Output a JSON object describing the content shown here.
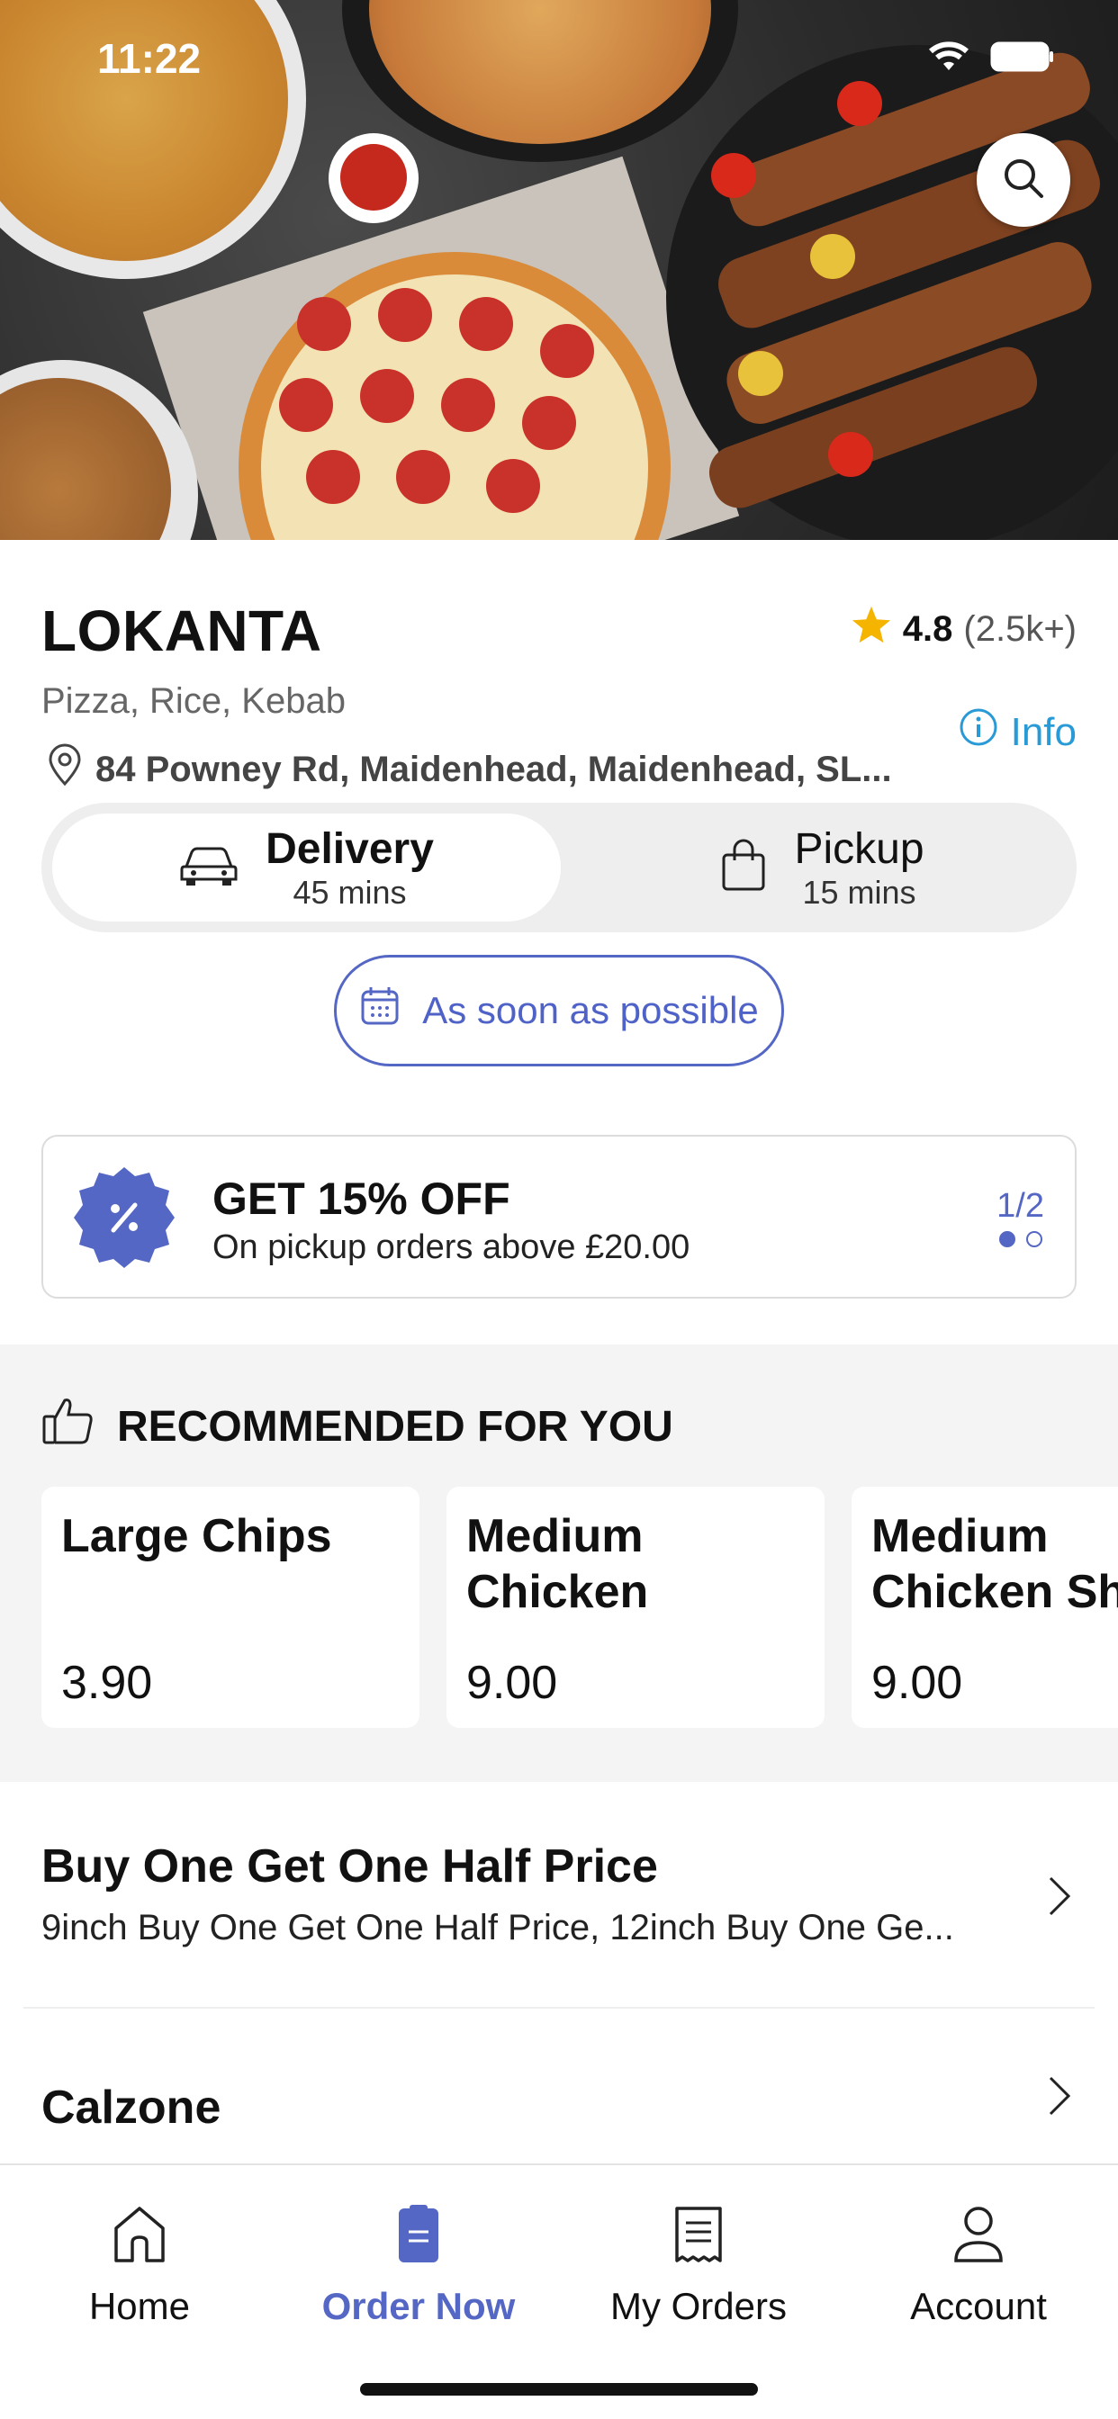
{
  "status": {
    "time": "11:22"
  },
  "restaurant": {
    "name": "LOKANTA",
    "rating": "4.8",
    "rating_count": "(2.5k+)",
    "cuisines": "Pizza, Rice, Kebab",
    "info_label": "Info",
    "address": "84 Powney Rd, Maidenhead, Maidenhead, SL..."
  },
  "order_mode": {
    "delivery": {
      "label": "Delivery",
      "time": "45 mins",
      "selected": true
    },
    "pickup": {
      "label": "Pickup",
      "time": "15 mins",
      "selected": false
    }
  },
  "schedule": {
    "label": "As soon as possible"
  },
  "promo": {
    "title": "GET 15% OFF",
    "subtitle": "On pickup orders above £20.00",
    "page": "1/2"
  },
  "recommended": {
    "title": "RECOMMENDED FOR YOU",
    "items": [
      {
        "name": "Large Chips",
        "price": "3.90"
      },
      {
        "name": "Medium Chicken Shish...",
        "price": "9.00"
      },
      {
        "name": "Medium Chicken Shi",
        "price": "9.00"
      }
    ]
  },
  "categories": [
    {
      "title": "Buy One Get One Half Price",
      "desc": "9inch Buy One Get One Half Price, 12inch Buy One Ge..."
    },
    {
      "title": "Calzone",
      "desc": ""
    }
  ],
  "tabs": [
    {
      "label": "Home",
      "active": false
    },
    {
      "label": "Order Now",
      "active": true
    },
    {
      "label": "My Orders",
      "active": false
    },
    {
      "label": "Account",
      "active": false
    }
  ],
  "colors": {
    "accent": "#5567c4",
    "info": "#2a9ad6",
    "star": "#f5b400"
  }
}
